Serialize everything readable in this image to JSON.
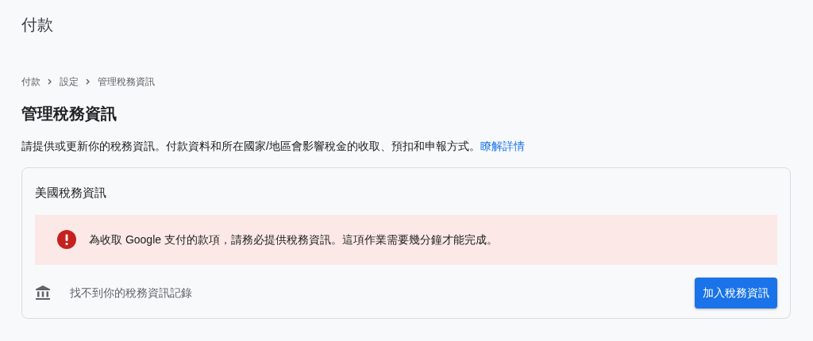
{
  "page_title": "付款",
  "breadcrumb": [
    {
      "label": "付款"
    },
    {
      "label": "設定"
    },
    {
      "label": "管理稅務資訊"
    }
  ],
  "heading": "管理稅務資訊",
  "description": {
    "text": "請提供或更新你的稅務資訊。付款資料和所在國家/地區會影響稅金的收取、預扣和申報方式。",
    "link": "瞭解詳情"
  },
  "card": {
    "title": "美國稅務資訊",
    "alert": {
      "kind": "error",
      "message": "為收取 Google 支付的款項，請務必提供稅務資訊。這項作業需要幾分鐘才能完成。"
    },
    "status": "找不到你的稅務資訊記錄",
    "button": "加入稅務資訊"
  }
}
